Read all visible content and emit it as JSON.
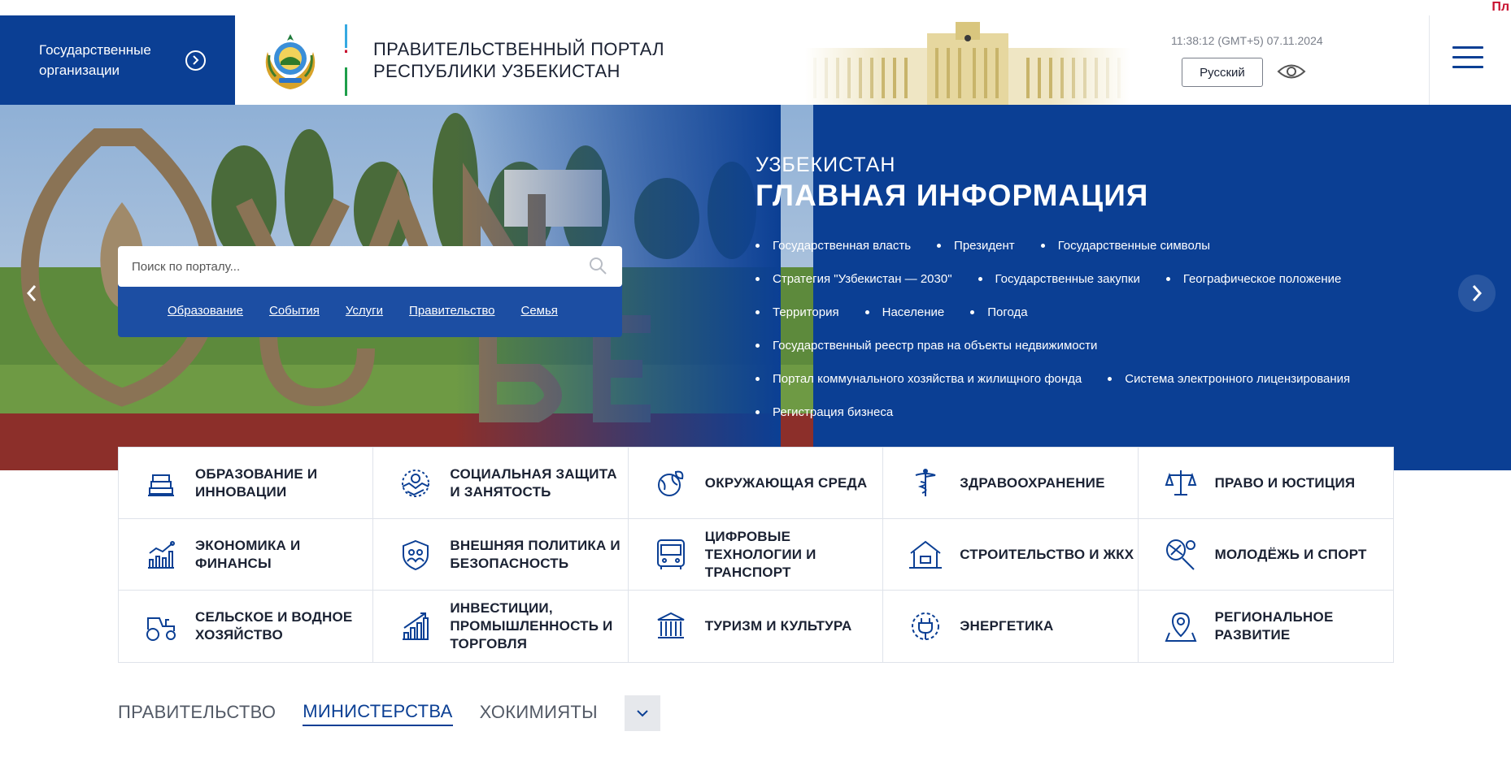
{
  "ticker": {
    "text": "Пл"
  },
  "header": {
    "gov_orgs_label": "Государственные организации",
    "portal_title_line1": "ПРАВИТЕЛЬСТВЕННЫЙ ПОРТАЛ",
    "portal_title_line2": "РЕСПУБЛИКИ УЗБЕКИСТАН",
    "clock": "11:38:12 (GMT+5) 07.11.2024",
    "language": "Русский"
  },
  "hero": {
    "search_placeholder": "Поиск по порталу...",
    "quick_links": [
      "Образование",
      "События",
      "Услуги",
      "Правительство",
      "Семья"
    ],
    "kicker": "УЗБЕКИСТАН",
    "title": "ГЛАВНАЯ ИНФОРМАЦИЯ",
    "links": [
      "Государственная власть",
      "Президент",
      "Государственные символы",
      "Стратегия \"Узбекистан — 2030\"",
      "Государственные закупки",
      "Географическое положение",
      "Территория",
      "Население",
      "Погода",
      "Государственный реестр прав на объекты недвижимости",
      "Портал коммунального хозяйства и жилищного фонда",
      "Система электронного лицензирования",
      "Регистрация бизнеса"
    ]
  },
  "categories": [
    {
      "label": "ОБРАЗОВАНИЕ И ИННОВАЦИИ",
      "icon": "books-icon"
    },
    {
      "label": "СОЦИАЛЬНАЯ ЗАЩИТА И ЗАНЯТОСТЬ",
      "icon": "handshake-icon"
    },
    {
      "label": "ОКРУЖАЮЩАЯ СРЕДА",
      "icon": "globe-leaf-icon"
    },
    {
      "label": "ЗДРАВООХРАНЕНИЕ",
      "icon": "caduceus-icon"
    },
    {
      "label": "ПРАВО И ЮСТИЦИЯ",
      "icon": "scales-icon"
    },
    {
      "label": "ЭКОНОМИКА И ФИНАНСЫ",
      "icon": "growth-chart-icon"
    },
    {
      "label": "ВНЕШНЯЯ ПОЛИТИКА И БЕЗОПАСНОСТЬ",
      "icon": "shield-people-icon"
    },
    {
      "label": "ЦИФРОВЫЕ ТЕХНОЛОГИИ И ТРАНСПОРТ",
      "icon": "bus-icon"
    },
    {
      "label": "СТРОИТЕЛЬСТВО И ЖКХ",
      "icon": "house-icon"
    },
    {
      "label": "МОЛОДЁЖЬ И СПОРТ",
      "icon": "tennis-icon"
    },
    {
      "label": "СЕЛЬСКОЕ И ВОДНОЕ ХОЗЯЙСТВО",
      "icon": "tractor-icon"
    },
    {
      "label": "ИНВЕСТИЦИИ, ПРОМЫШЛЕННОСТЬ И ТОРГОВЛЯ",
      "icon": "bar-chart-icon"
    },
    {
      "label": "ТУРИЗМ И КУЛЬТУРА",
      "icon": "museum-icon"
    },
    {
      "label": "ЭНЕРГЕТИКА",
      "icon": "plug-icon"
    },
    {
      "label": "РЕГИОНАЛЬНОЕ РАЗВИТИЕ",
      "icon": "map-pin-icon"
    }
  ],
  "tabs": {
    "items": [
      "ПРАВИТЕЛЬСТВО",
      "МИНИСТЕРСТВА",
      "ХОКИМИЯТЫ"
    ],
    "active": "МИНИСТЕРСТВА"
  },
  "colors": {
    "brand_blue": "#0b3f94",
    "text_dark": "#1b2233",
    "ticker_red": "#c8102e"
  }
}
